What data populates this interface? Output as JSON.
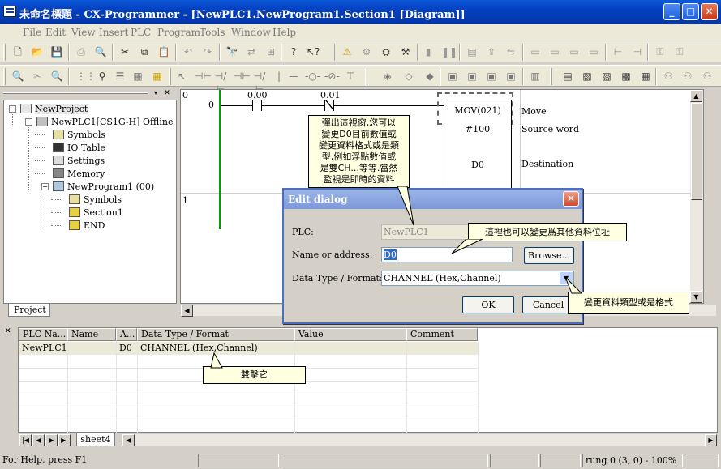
{
  "window": {
    "title": "未命名標題 - CX-Programmer - [NewPLC1.NewProgram1.Section1 [Diagram]]"
  },
  "menu": [
    "File",
    "Edit",
    "View",
    "Insert",
    "PLC",
    "Program",
    "Tools",
    "Window",
    "Help"
  ],
  "tree": {
    "root": "NewProject",
    "plc": "NewPLC1[CS1G-H] Offline",
    "plc_children": [
      "Symbols",
      "IO Table",
      "Settings",
      "Memory"
    ],
    "program": "NewProgram1 (00)",
    "program_children": [
      "Symbols",
      "Section1",
      "END"
    ],
    "tab": "Project"
  },
  "diagram": {
    "rung0_col": "0",
    "rung0_num": "0",
    "rung1_num": "1",
    "contact1": "0.00",
    "contact2": "0.01",
    "instruction": "MOV(021)",
    "operand1": "#100",
    "operand2": "D0",
    "comment_move": "Move",
    "comment_source": "Source word",
    "comment_dest": "Destination"
  },
  "dialog": {
    "title": "Edit dialog",
    "plc_label": "PLC:",
    "plc_value": "NewPLC1",
    "name_label": "Name or address:",
    "name_value": "D0",
    "browse": "Browse...",
    "type_label": "Data Type / Format:",
    "type_value": "CHANNEL (Hex,Channel)",
    "ok": "OK",
    "cancel": "Cancel"
  },
  "callouts": {
    "popup": [
      "彈出這視窗,您可以",
      "變更D0目前數值或",
      "變更資料格式或是類",
      "型,例如浮點數值或",
      "是雙CH...等等.當然",
      "監視是即時的資料"
    ],
    "address": "這裡也可以變更爲其他資料位址",
    "format": "變更資料類型或是格式",
    "dblclick": "雙擊它"
  },
  "watch": {
    "headers": [
      "PLC Na...",
      "Name",
      "A...",
      "Data Type / Format",
      "Value",
      "Comment"
    ],
    "row": [
      "NewPLC1",
      "",
      "D0",
      "CHANNEL (Hex,Channel)",
      "",
      ""
    ],
    "sheet_tab": "sheet4"
  },
  "status": {
    "help": "For Help, press F1",
    "position": "rung 0 (3, 0)  - 100%"
  },
  "colors": {
    "titlebar": "#0540c0",
    "callout": "#ffffe1",
    "rung": "#00a000"
  }
}
